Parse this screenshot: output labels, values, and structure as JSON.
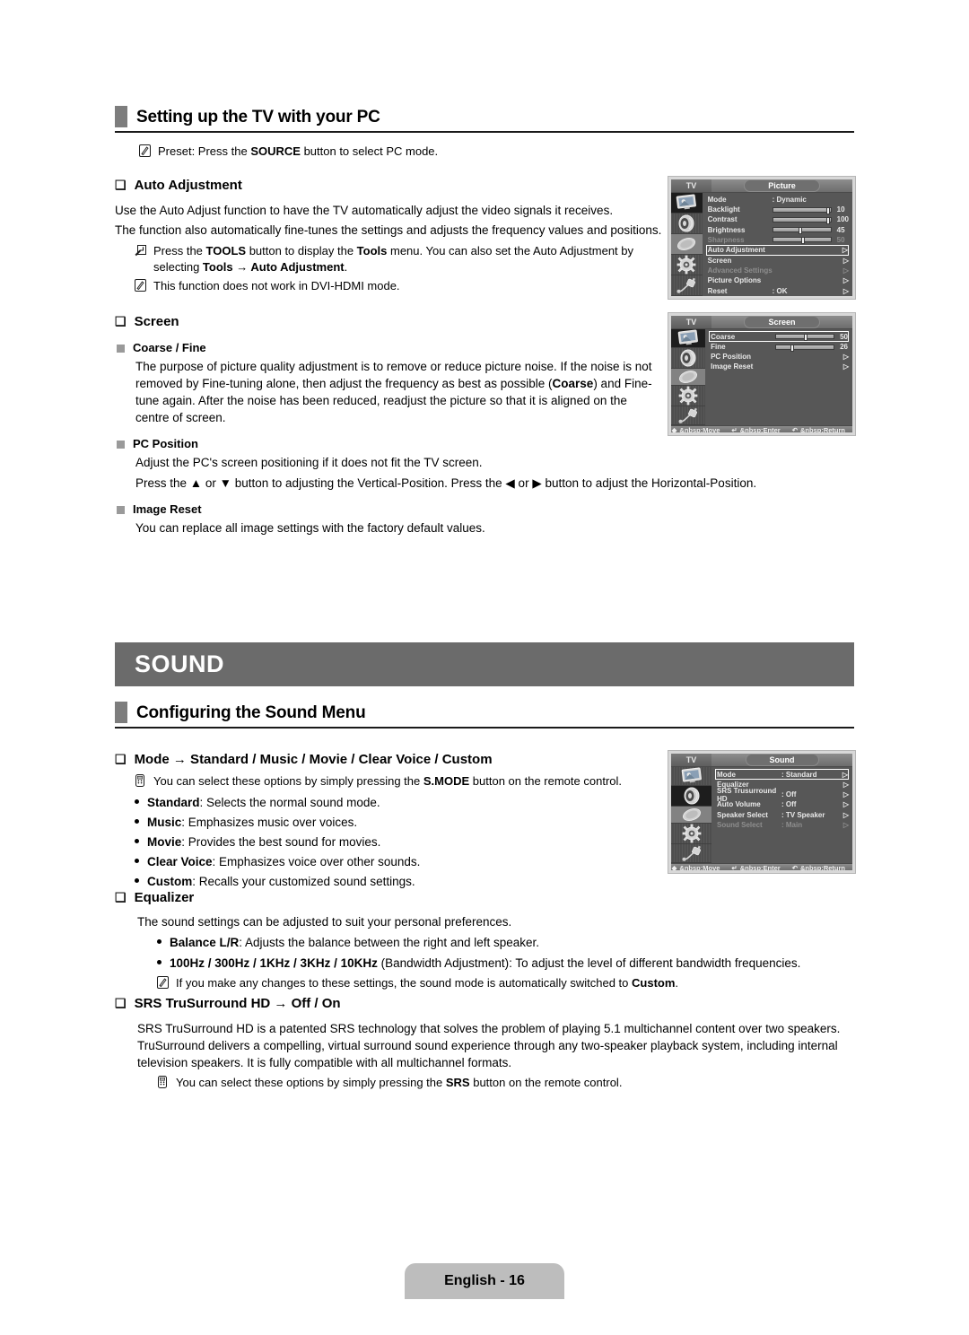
{
  "page": {
    "footer_label": "English - 16"
  },
  "section_pc": {
    "heading": "Setting up the TV with your PC",
    "preset_note_pre": "Preset: Press the ",
    "preset_note_bold": "SOURCE",
    "preset_note_post": " button to select PC mode.",
    "auto_adjustment": {
      "heading": "Auto Adjustment",
      "para1": "Use the Auto Adjust function to have the TV automatically adjust the video signals it receives.",
      "para2": "The function also automatically fine-tunes the settings and adjusts the frequency values and positions.",
      "tools_note_a": "Press the ",
      "tools_note_b": "TOOLS",
      "tools_note_c": " button to display the ",
      "tools_note_d": "Tools",
      "tools_note_e": " menu. You can also set the Auto Adjustment by selecting ",
      "tools_note_f": "Tools → Auto Adjustment",
      "tools_note_g": ".",
      "dvi_note": "This function does not work in DVI-HDMI mode."
    },
    "screen": {
      "heading": "Screen",
      "coarse_fine": {
        "title": "Coarse / Fine",
        "text_a": "The purpose of picture quality adjustment is to remove or reduce picture noise. If the noise is not removed by Fine-tuning alone, then adjust the frequency as best as possible (",
        "text_b": "Coarse",
        "text_c": ") and Fine-tune again. After the noise has been reduced, readjust the picture so that it is aligned on the centre of screen."
      },
      "pc_position": {
        "title": "PC Position",
        "line1": "Adjust the PC's screen positioning if it does not fit the TV screen.",
        "line2": "Press the ▲ or ▼ button to adjusting the Vertical-Position. Press the ◀ or ▶ button to adjust the Horizontal-Position."
      },
      "image_reset": {
        "title": "Image Reset",
        "line1": "You can replace all image settings with the factory default values."
      }
    }
  },
  "section_sound": {
    "banner": "SOUND",
    "heading": "Configuring the Sound Menu",
    "mode": {
      "heading": "Mode → Standard / Music / Movie / Clear Voice / Custom",
      "note_a": "You can select these options by simply pressing the ",
      "note_b": "S.MODE",
      "note_c": " button on the remote control.",
      "items": [
        {
          "term": "Standard",
          "desc": ": Selects the normal sound mode."
        },
        {
          "term": "Music",
          "desc": ": Emphasizes music over voices."
        },
        {
          "term": "Movie",
          "desc": ": Provides the best sound for movies."
        },
        {
          "term": "Clear Voice",
          "desc": ": Emphasizes voice over other sounds."
        },
        {
          "term": "Custom",
          "desc": ": Recalls your customized sound settings."
        }
      ]
    },
    "equalizer": {
      "heading": "Equalizer",
      "intro": "The sound settings can be adjusted to suit your personal preferences.",
      "items": [
        {
          "term": "Balance L/R",
          "desc": ": Adjusts the balance between the right and left speaker."
        },
        {
          "term": "100Hz / 300Hz / 1KHz / 3KHz / 10KHz",
          "desc": " (Bandwidth Adjustment): To adjust the level of different bandwidth frequencies."
        }
      ],
      "note_a": "If you make any changes to these settings, the sound mode is automatically switched to ",
      "note_b": "Custom",
      "note_c": "."
    },
    "srs": {
      "heading": "SRS TruSurround HD → Off / On",
      "para": "SRS TruSurround HD is a patented SRS technology that solves the problem of playing 5.1 multichannel content over two speakers. TruSurround delivers a compelling, virtual surround sound experience through any two-speaker playback system, including internal television speakers. It is fully compatible with all multichannel formats.",
      "note_a": "You can select these options by simply pressing the ",
      "note_b": "SRS",
      "note_c": " button on the remote control."
    }
  },
  "osd_common": {
    "tv_label": "TV",
    "move": "Move",
    "enter": "Enter",
    "return": "Return"
  },
  "osd_picture": {
    "title": "Picture",
    "rows": [
      {
        "label": "Mode",
        "value": ": Dynamic",
        "type": "value",
        "dim": false,
        "highlight": false
      },
      {
        "label": "Backlight",
        "value": "10",
        "type": "slider",
        "slider_pct": 96,
        "dim": false,
        "highlight": false
      },
      {
        "label": "Contrast",
        "value": "100",
        "type": "slider",
        "slider_pct": 96,
        "dim": false,
        "highlight": false
      },
      {
        "label": "Brightness",
        "value": "45",
        "type": "slider",
        "slider_pct": 45,
        "dim": false,
        "highlight": false
      },
      {
        "label": "Sharpness",
        "value": "50",
        "type": "slider",
        "slider_pct": 50,
        "dim": true,
        "highlight": false
      },
      {
        "label": "Auto Adjustment",
        "value": "",
        "type": "arrow",
        "dim": false,
        "highlight": true
      },
      {
        "label": "Screen",
        "value": "",
        "type": "arrow",
        "dim": false,
        "highlight": false
      },
      {
        "label": "Advanced Settings",
        "value": "",
        "type": "arrow",
        "dim": true,
        "highlight": false
      },
      {
        "label": "Picture Options",
        "value": "",
        "type": "arrow",
        "dim": false,
        "highlight": false
      },
      {
        "label": "Reset",
        "value": ": OK",
        "type": "value-arrow",
        "dim": false,
        "highlight": false
      }
    ],
    "selected_rail_index": 0
  },
  "osd_screen": {
    "title": "Screen",
    "rows": [
      {
        "label": "Coarse",
        "value": "50",
        "type": "slider",
        "slider_pct": 50,
        "dim": false,
        "highlight": true
      },
      {
        "label": "Fine",
        "value": "26",
        "type": "slider",
        "slider_pct": 26,
        "dim": false,
        "highlight": false
      },
      {
        "label": "PC Position",
        "value": "",
        "type": "arrow",
        "dim": false,
        "highlight": false
      },
      {
        "label": "Image Reset",
        "value": "",
        "type": "arrow",
        "dim": false,
        "highlight": false
      }
    ],
    "selected_rail_index": 0
  },
  "osd_sound": {
    "title": "Sound",
    "rows": [
      {
        "label": "Mode",
        "value": ": Standard",
        "type": "value-arrow",
        "dim": false,
        "highlight": true
      },
      {
        "label": "Equalizer",
        "value": "",
        "type": "arrow",
        "dim": false,
        "highlight": false
      },
      {
        "label": "SRS Trusurround HD",
        "value": ": Off",
        "type": "value-arrow",
        "dim": false,
        "highlight": false
      },
      {
        "label": "Auto Volume",
        "value": ": Off",
        "type": "value-arrow",
        "dim": false,
        "highlight": false
      },
      {
        "label": "Speaker Select",
        "value": ": TV Speaker",
        "type": "value-arrow",
        "dim": false,
        "highlight": false
      },
      {
        "label": "Sound Select",
        "value": ": Main",
        "type": "value-arrow",
        "dim": true,
        "highlight": false
      }
    ],
    "selected_rail_index": 1
  },
  "colors": {
    "banner_bg": "#6b6b6b",
    "heading_bar": "#7d7d7d",
    "page_pill": "#bdbdbd",
    "osd_bg": "#575757"
  }
}
